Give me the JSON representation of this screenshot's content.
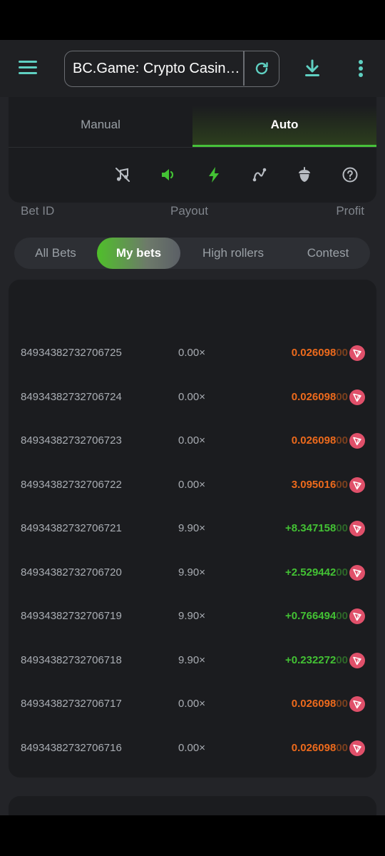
{
  "browser": {
    "title": "BC.Game: Crypto Casino Games & Casino Slot Games"
  },
  "colors": {
    "accent": "#5fd0c2",
    "green": "#43c234",
    "orange": "#ed6a1c",
    "coin": "#e0506a"
  },
  "mode_tabs": {
    "manual": "Manual",
    "auto": "Auto"
  },
  "tool_icons": [
    "music-off-icon",
    "sound-icon",
    "lightning-icon",
    "graph-curve-icon",
    "acorn-icon",
    "help-icon"
  ],
  "filter_tabs": {
    "all": "All Bets",
    "my": "My bets",
    "high": "High rollers",
    "contest": "Contest"
  },
  "table": {
    "headers": {
      "bet_id": "Bet ID",
      "payout": "Payout",
      "profit": "Profit"
    },
    "rows": [
      {
        "id": "84934382732706725",
        "payout": "0.00×",
        "profit_main": "0.026098",
        "profit_tail": "00",
        "sign": "neg"
      },
      {
        "id": "84934382732706724",
        "payout": "0.00×",
        "profit_main": "0.026098",
        "profit_tail": "00",
        "sign": "neg"
      },
      {
        "id": "84934382732706723",
        "payout": "0.00×",
        "profit_main": "0.026098",
        "profit_tail": "00",
        "sign": "neg"
      },
      {
        "id": "84934382732706722",
        "payout": "0.00×",
        "profit_main": "3.095016",
        "profit_tail": "00",
        "sign": "neg"
      },
      {
        "id": "84934382732706721",
        "payout": "9.90×",
        "profit_main": "+8.347158",
        "profit_tail": "00",
        "sign": "pos"
      },
      {
        "id": "84934382732706720",
        "payout": "9.90×",
        "profit_main": "+2.529442",
        "profit_tail": "00",
        "sign": "pos"
      },
      {
        "id": "84934382732706719",
        "payout": "9.90×",
        "profit_main": "+0.766494",
        "profit_tail": "00",
        "sign": "pos"
      },
      {
        "id": "84934382732706718",
        "payout": "9.90×",
        "profit_main": "+0.232272",
        "profit_tail": "00",
        "sign": "pos"
      },
      {
        "id": "84934382732706717",
        "payout": "0.00×",
        "profit_main": "0.026098",
        "profit_tail": "00",
        "sign": "neg"
      },
      {
        "id": "84934382732706716",
        "payout": "0.00×",
        "profit_main": "0.026098",
        "profit_tail": "00",
        "sign": "neg"
      }
    ]
  }
}
